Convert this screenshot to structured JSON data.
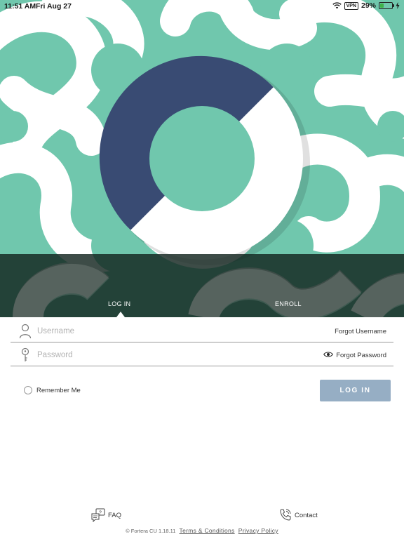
{
  "status_bar": {
    "time": "11:51 AM",
    "date": "Fri Aug 27",
    "vpn": "VPN",
    "battery_pct": "29%",
    "battery_level": 0.29
  },
  "colors": {
    "hero_green": "#70c7ad",
    "logo_navy": "#394b73",
    "button_blue": "#96aec4"
  },
  "tabs": [
    {
      "label": "LOG IN",
      "active": true
    },
    {
      "label": "ENROLL",
      "active": false
    }
  ],
  "form": {
    "username": {
      "placeholder": "Username",
      "value": "",
      "link": "Forgot Username",
      "icon": "person-icon"
    },
    "password": {
      "placeholder": "Password",
      "value": "",
      "link": "Forgot Password",
      "icon": "key-icon",
      "toggle_icon": "eye-icon"
    },
    "remember_label": "Remember Me",
    "remember_checked": false,
    "login_button": "LOG IN"
  },
  "footer": {
    "faq": "FAQ",
    "contact": "Contact",
    "copyright": "© Fortera CU 1.18.11",
    "terms": "Terms & Conditions",
    "privacy": "Privacy Policy"
  }
}
